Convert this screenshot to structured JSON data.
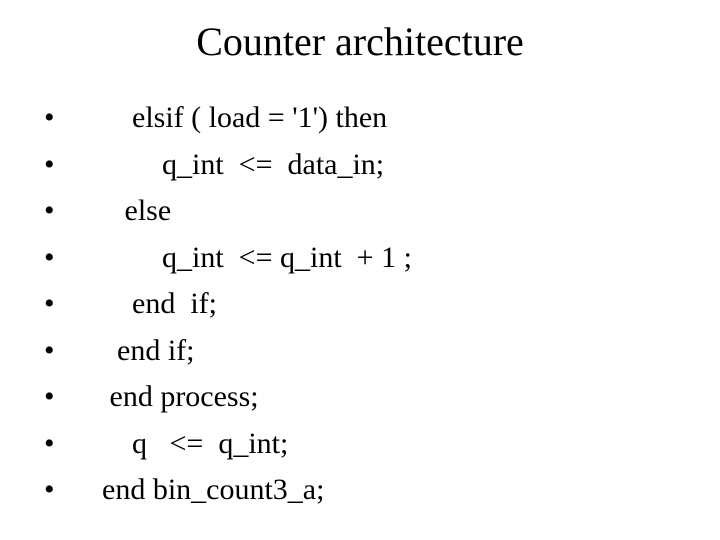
{
  "title": "Counter architecture",
  "lines": [
    "    elsif ( load = '1') then",
    "        q_int  <=  data_in;",
    "   else",
    "        q_int  <= q_int  + 1 ;",
    "    end  if;",
    "  end if;",
    " end process;",
    "    q   <=  q_int;",
    "end bin_count3_a;"
  ]
}
